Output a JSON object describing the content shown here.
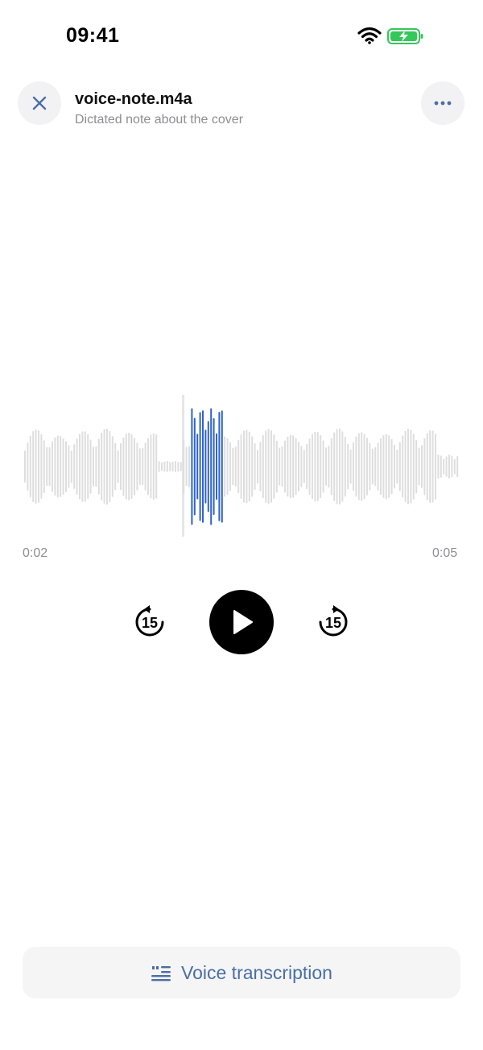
{
  "status_bar": {
    "time": "09:41"
  },
  "header": {
    "title": "voice-note.m4a",
    "subtitle": "Dictated note about the cover"
  },
  "player": {
    "current_time": "0:02",
    "total_time": "0:05",
    "skip_back_seconds": "15",
    "skip_forward_seconds": "15",
    "progress": 0.4
  },
  "transcription_button": {
    "label": "Voice transcription"
  },
  "colors": {
    "accent": "#4a6fa5",
    "waveform_played": "#2e63d1",
    "waveform_unplayed": "#dedede",
    "battery_green": "#34c759"
  }
}
